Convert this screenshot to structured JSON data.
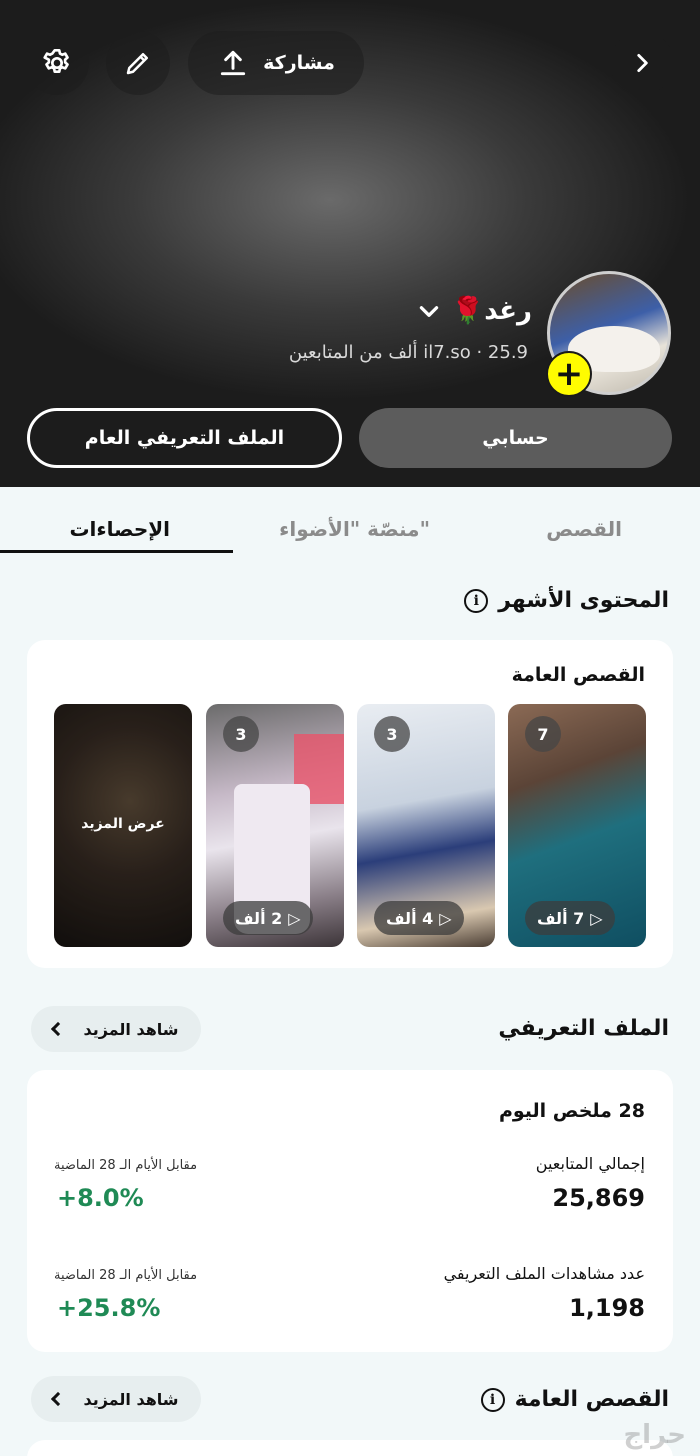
{
  "header": {
    "share_label": "مشاركة",
    "settings_icon": "gear-icon",
    "edit_icon": "pencil-icon",
    "back_icon": "chevron-right-icon",
    "name": "رغد🌹",
    "sub_info": "il7.so · 25.9 ألف من المتابعين",
    "my_account_label": "حسابي",
    "public_profile_label": "الملف التعريفي العام",
    "add_icon": "plus-icon"
  },
  "tabs": {
    "stories": "القصص",
    "spotlight": "منصّة \"الأضواء\"",
    "insights": "الإحصاءات"
  },
  "top_content": {
    "title": "المحتوى الأشهر",
    "card_label": "القصص العامة",
    "thumbnails": [
      {
        "count": "7",
        "views": "7 ألف"
      },
      {
        "count": "3",
        "views": "4 ألف"
      },
      {
        "count": "3",
        "views": "2 ألف"
      },
      {
        "overlay": "عرض المزيد"
      }
    ]
  },
  "profile": {
    "title": "الملف التعريفي",
    "see_more": "شاهد المزيد",
    "summary_title": "28 ملخص اليوم",
    "total_followers_label": "إجمالي المتابعين",
    "total_followers_value": "25,869",
    "followers_compare_label": "مقابل الأيام الـ 28 الماضية",
    "followers_change": "+8.0%",
    "profile_views_label": "عدد مشاهدات الملف التعريفي",
    "profile_views_value": "1,198",
    "views_compare_label": "مقابل الأيام الـ 28 الماضية",
    "views_change": "+25.8%"
  },
  "public_stories": {
    "title": "القصص العامة",
    "see_more": "شاهد المزيد"
  },
  "watermark": "حراج",
  "colors": {
    "accent_yellow": "#fffc00",
    "positive_green": "#1f8a55"
  }
}
